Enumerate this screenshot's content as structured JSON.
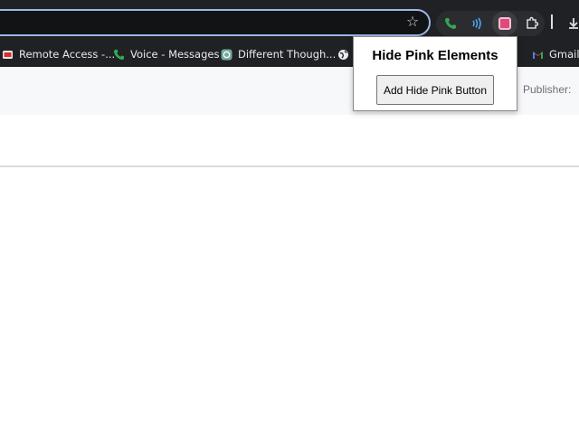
{
  "toolbar": {
    "star_icon": "star-icon",
    "extensions": [
      {
        "name": "phone-extension-icon",
        "color": "#34a853"
      },
      {
        "name": "wireless-extension-icon",
        "color": "#4aa3f0"
      },
      {
        "name": "hide-pink-extension-icon",
        "color": "#e04a7a"
      },
      {
        "name": "extensions-puzzle-icon",
        "color": "#dadce0"
      }
    ],
    "download_icon": "download-icon"
  },
  "bookmarks": [
    {
      "label": "Remote Access -...",
      "icon": "remote-access-icon"
    },
    {
      "label": "Voice - Messages",
      "icon": "phone-icon"
    },
    {
      "label": "Different Though...",
      "icon": "chatgpt-icon"
    },
    {
      "label": "",
      "icon": "globe-icon"
    },
    {
      "label": "Gmail",
      "icon": "gmail-icon"
    }
  ],
  "page": {
    "publisher_label": "Publisher:"
  },
  "popup": {
    "title": "Hide Pink Elements",
    "button_label": "Add Hide Pink Button"
  },
  "colors": {
    "toolbar_bg": "#202124",
    "omnibox_border": "#9ab7e8",
    "pink_accent": "#e04a7a"
  }
}
